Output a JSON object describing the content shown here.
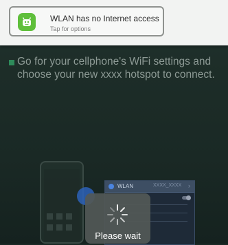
{
  "notification": {
    "title": "WLAN has no Internet access",
    "subtitle": "Tap for options",
    "icon": "android-robot-icon",
    "accent_color": "#5fbf3b"
  },
  "instruction": {
    "text": "Go for your cellphone's WiFi settings and choose your new  xxxx  hotspot to connect."
  },
  "illustration": {
    "wifi_label": "WLAN",
    "wifi_ssid": "XXXX_XXXX"
  },
  "wait_dialog": {
    "label": "Please wait"
  }
}
